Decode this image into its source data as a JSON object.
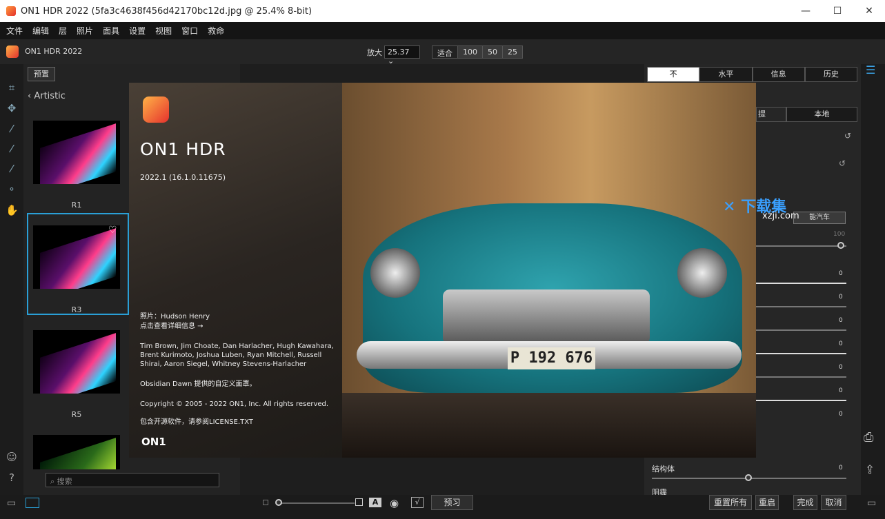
{
  "window": {
    "title": "ON1 HDR 2022 (5fa3c4638f456d42170bc12d.jpg @ 25.4% 8-bit)",
    "min": "—",
    "max": "☐",
    "close": "✕"
  },
  "menu": [
    "文件",
    "编辑",
    "层",
    "照片",
    "面具",
    "设置",
    "视图",
    "窗口",
    "救命"
  ],
  "app": {
    "name": "ON1 HDR 2022",
    "zoom_label": "放大",
    "zoom_value": "25.37",
    "zoom_buttons": [
      "适合",
      "100",
      "50",
      "25"
    ]
  },
  "browser": {
    "preset_button": "预置",
    "category": "Artistic",
    "thumbs": [
      {
        "label": "R1"
      },
      {
        "label": "R3"
      },
      {
        "label": "R5"
      }
    ],
    "search_placeholder": "搜索"
  },
  "right": {
    "tabs": [
      "不",
      "水平",
      "信息",
      "历史"
    ],
    "tab2": "本地",
    "tab2b": "提",
    "hidden_btn": "能汽车",
    "slider_max": "100",
    "values": [
      "0",
      "0",
      "0",
      "0",
      "0",
      "0",
      "0"
    ],
    "structure_label": "结构体",
    "structure_value": "0",
    "haze_label": "阴霾"
  },
  "bottom": {
    "preview": "预习",
    "reset_all": "重置所有",
    "reset": "重启",
    "done": "完成",
    "cancel": "取消",
    "text_icon": "A"
  },
  "splash": {
    "title": "ON1 HDR",
    "version": "2022.1 (16.1.0.11675)",
    "photo_credit": "照片：Hudson Henry",
    "details_link": "点击查看详细信息 →",
    "credits": "Tim Brown, Jim Choate, Dan Harlacher, Hugh Kawahara, Brent Kurimoto, Joshua Luben, Ryan Mitchell, Russell Shirai, Aaron Siegel, Whitney Stevens-Harlacher",
    "theme": "Obsidian Dawn 提供的自定义面罩。",
    "copyright": "Copyright © 2005 - 2022 ON1, Inc. All rights reserved.",
    "license": "包含开源软件，请参阅LICENSE.TXT",
    "logo": "ON1",
    "plate": "P 192 676"
  },
  "watermark": {
    "cn": "下载集",
    "url": "xzji.com"
  }
}
